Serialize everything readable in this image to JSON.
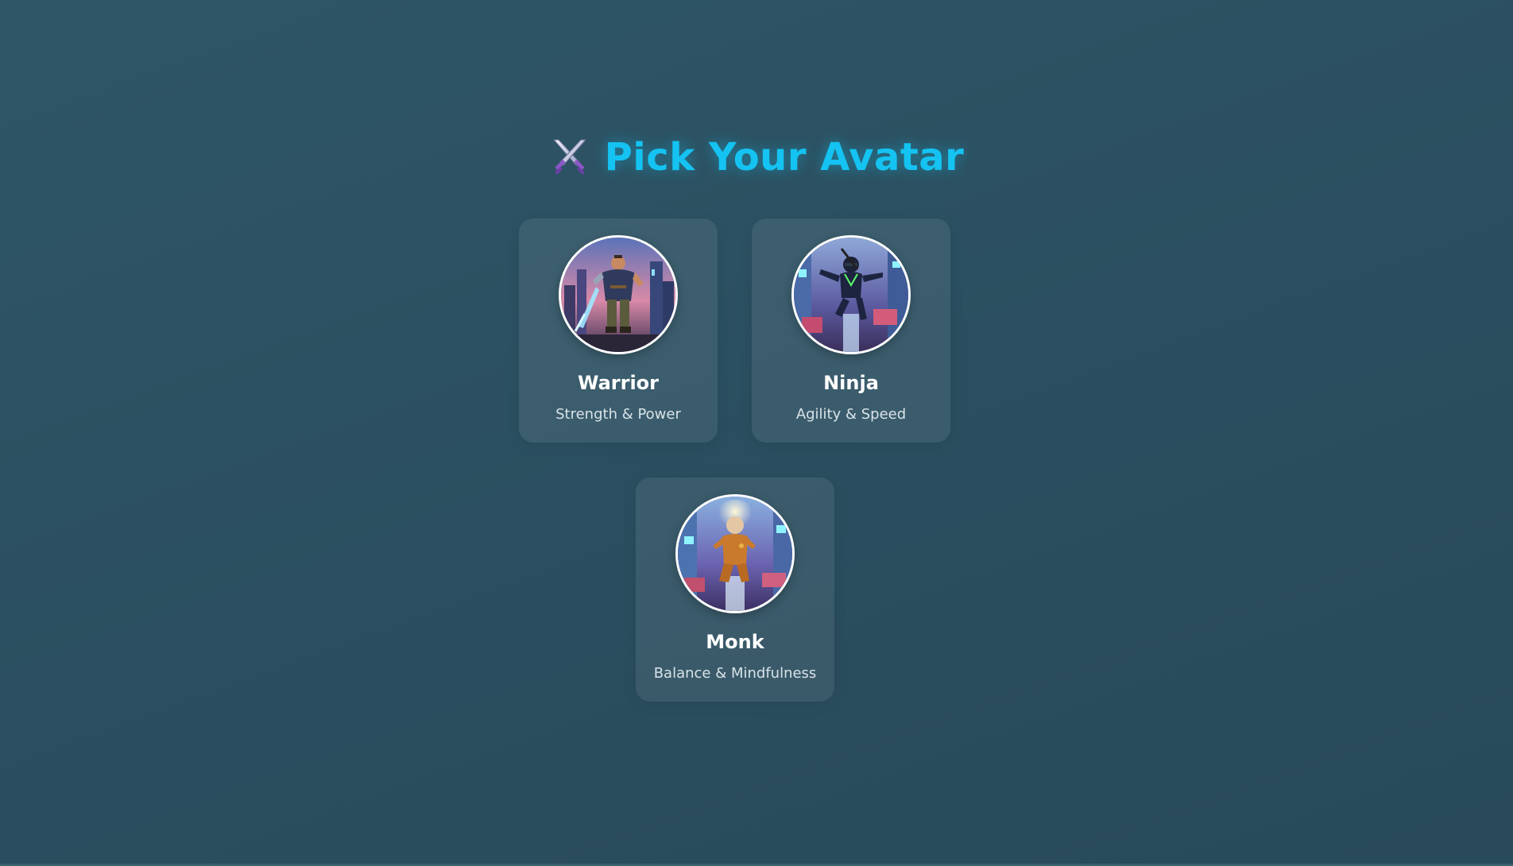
{
  "header": {
    "title": "Pick Your Avatar",
    "icon": "crossed-swords-icon"
  },
  "avatars": [
    {
      "name": "Warrior",
      "description": "Strength & Power",
      "image": "warrior-portrait"
    },
    {
      "name": "Ninja",
      "description": "Agility & Speed",
      "image": "ninja-portrait"
    },
    {
      "name": "Monk",
      "description": "Balance & Mindfulness",
      "image": "monk-portrait"
    }
  ],
  "colors": {
    "accent": "#14c3f2",
    "background": "#2b4f60",
    "card": "#3b5e6c"
  }
}
